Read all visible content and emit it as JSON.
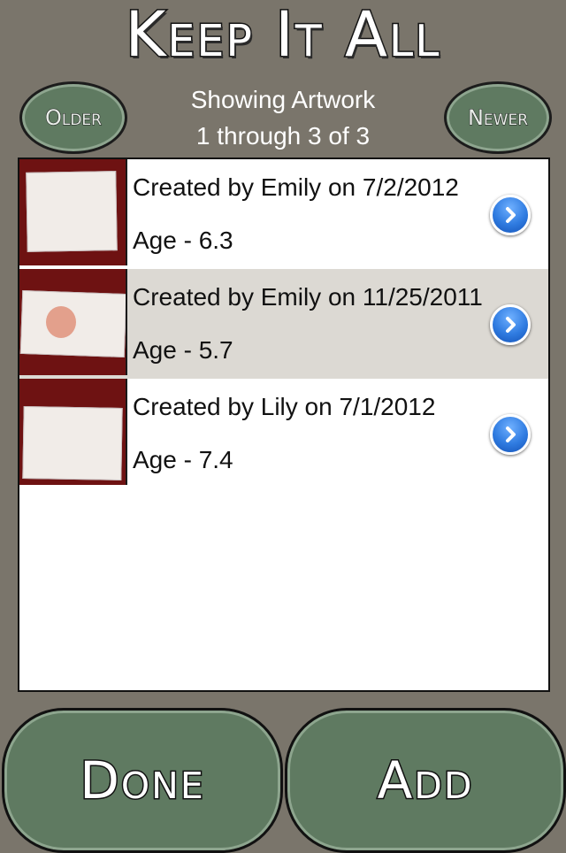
{
  "header": {
    "title": "Keep It All",
    "older_label": "Older",
    "newer_label": "Newer",
    "showing_line1": "Showing Artwork",
    "showing_line2": "1 through 3 of 3"
  },
  "items": [
    {
      "line1": "Created by Emily on 7/2/2012",
      "line2": "Age - 6.3",
      "selected": false,
      "icon": "chevron-right-icon"
    },
    {
      "line1": "Created by Emily on 11/25/2011",
      "line2": "Age - 5.7",
      "selected": true,
      "icon": "chevron-right-icon"
    },
    {
      "line1": "Created by Lily on 7/1/2012",
      "line2": "Age - 7.4",
      "selected": false,
      "icon": "chevron-right-icon"
    }
  ],
  "footer": {
    "done_label": "Done",
    "add_label": "Add"
  },
  "colors": {
    "background": "#7a756b",
    "button_green": "#5f7a61",
    "selected_row": "#dcd9d3",
    "disclosure_blue": "#2f7be0"
  }
}
